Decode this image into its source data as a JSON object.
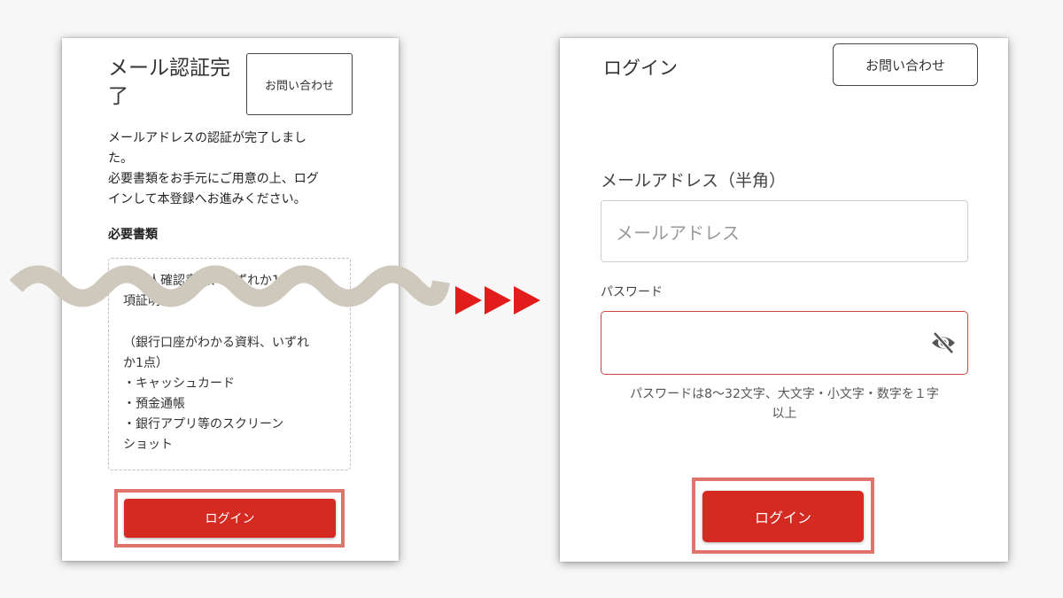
{
  "left": {
    "title": "メール認証完\n了",
    "contact_label": "お問い合わせ",
    "description": "メールアドレスの認証が完了しまし\nた。\n必要書類をお手元にご用意の上、ログ\nインして本登録へお進みください。",
    "docs_heading": "必要書類",
    "docs_group1": "（本人確認書類、いずれか1点）\n項証明書",
    "docs_group2": "（銀行口座がわかる資料、いずれ\nか1点）\n・キャッシュカード\n・預金通帳\n・銀行アプリ等のスクリーン\nショット",
    "login_label": "ログイン"
  },
  "right": {
    "title": "ログイン",
    "contact_label": "お問い合わせ",
    "email_label": "メールアドレス（半角）",
    "email_placeholder": "メールアドレス",
    "email_value": "",
    "password_label": "パスワード",
    "password_value": "",
    "password_hint": "パスワードは8〜32文字、大文字・小文字・数字を１字\n以上",
    "login_label": "ログイン"
  },
  "icons": {
    "eye": "eye-off-icon",
    "arrow": "triangle-right-icon"
  },
  "colors": {
    "accent_red": "#d52a22",
    "highlight": "#e0746c",
    "error_border": "#c94b44",
    "wave": "#cfc8bd",
    "arrow": "#e21b1b"
  }
}
